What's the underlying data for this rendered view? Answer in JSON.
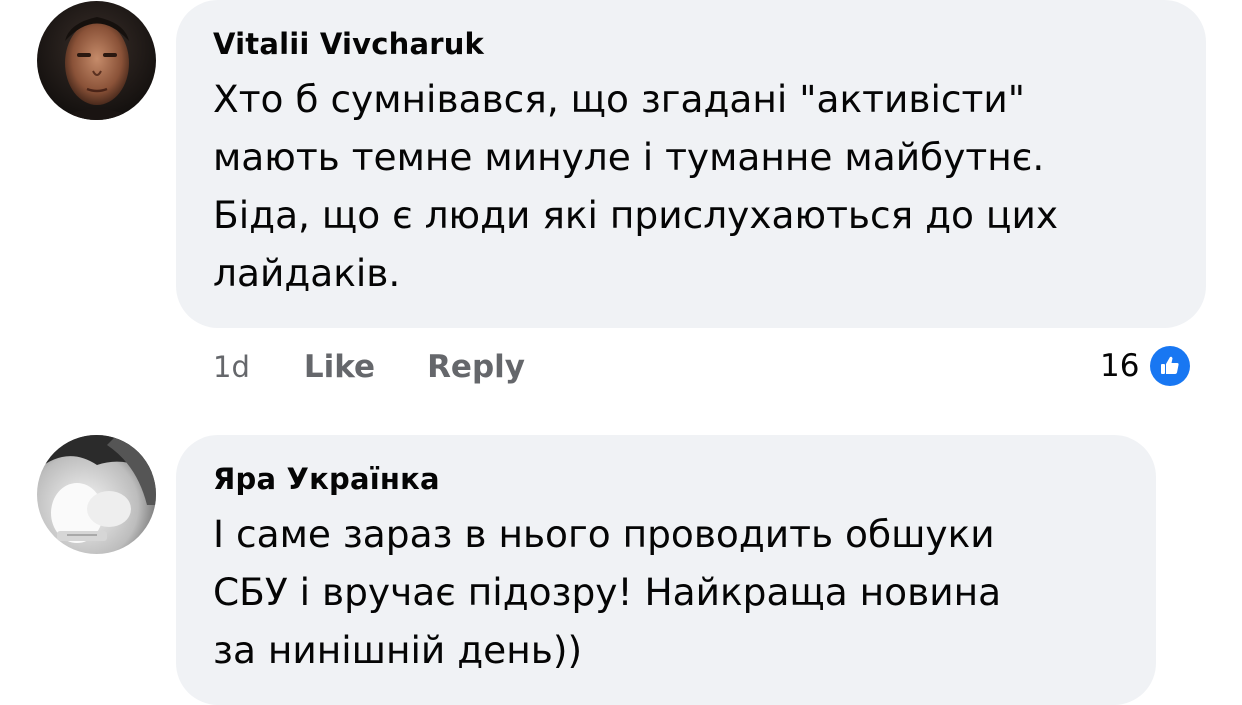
{
  "comments": [
    {
      "author": "Vitalii Vivcharuk",
      "lines": [
        "Хто б сумнівався, що згадані \"активісти\"",
        "мають темне минуле і туманне майбутнє.",
        "Біда, що є люди які прислухаються до цих",
        "лайдаків."
      ],
      "time": "1d",
      "like_label": "Like",
      "reply_label": "Reply",
      "reaction_count": "16",
      "reaction_icon": "thumbs-up-icon"
    },
    {
      "author": "Яра Українка",
      "lines": [
        "І саме зараз в нього проводить обшуки",
        "СБУ і вручає підозру! Найкраща новина",
        "за нинішній день))"
      ]
    }
  ],
  "colors": {
    "bubble": "#f0f2f5",
    "text": "#050505",
    "meta": "#65676b",
    "like_blue": "#1877f2"
  }
}
